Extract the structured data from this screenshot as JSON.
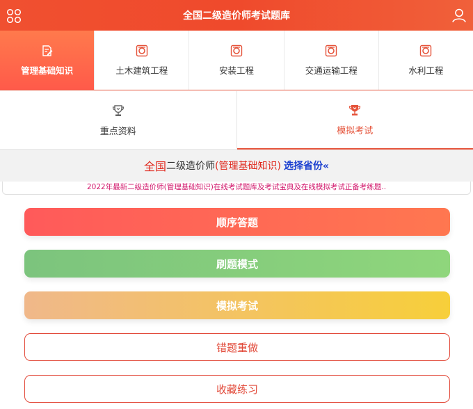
{
  "header": {
    "title": "全国二级造价师考试题库",
    "menu_icon": "grid-menu-icon",
    "user_icon": "user-icon"
  },
  "subjects": [
    {
      "label": "管理基础知识",
      "icon": "edit-document-icon",
      "active": true
    },
    {
      "label": "土木建筑工程",
      "icon": "record-icon",
      "active": false
    },
    {
      "label": "安装工程",
      "icon": "record-icon",
      "active": false
    },
    {
      "label": "交通运输工程",
      "icon": "record-icon",
      "active": false
    },
    {
      "label": "水利工程",
      "icon": "record-icon",
      "active": false
    }
  ],
  "modes": [
    {
      "label": "重点资料",
      "icon": "trophy-icon",
      "active": false
    },
    {
      "label": "模拟考试",
      "icon": "trophy-icon",
      "active": true
    }
  ],
  "exam_bar": {
    "prefix": "全国",
    "middle": "二级造价师",
    "subject": "(管理基础知识)",
    "choose": "选择省份«"
  },
  "notice": "2022年最新二级造价师(管理基础知识)在线考试题库及考试宝典及在线模拟考试正备考练题..",
  "buttons": {
    "sequence": "顺序答题",
    "brush": "刷题模式",
    "mock": "模拟考试",
    "wrong": "错题重做",
    "favorites": "收藏练习"
  },
  "colors": {
    "accent": "#e5533a",
    "header_bg": "#ef4a2c",
    "sequence_gradient": [
      "#ff5a5a",
      "#ff7750"
    ],
    "brush_gradient": [
      "#7cc47d",
      "#8fd67c"
    ],
    "mock_gradient": [
      "#f0b88a",
      "#f7cf3a"
    ],
    "notice_text": "#d2186c",
    "choose_province": "#1a3fd0"
  }
}
